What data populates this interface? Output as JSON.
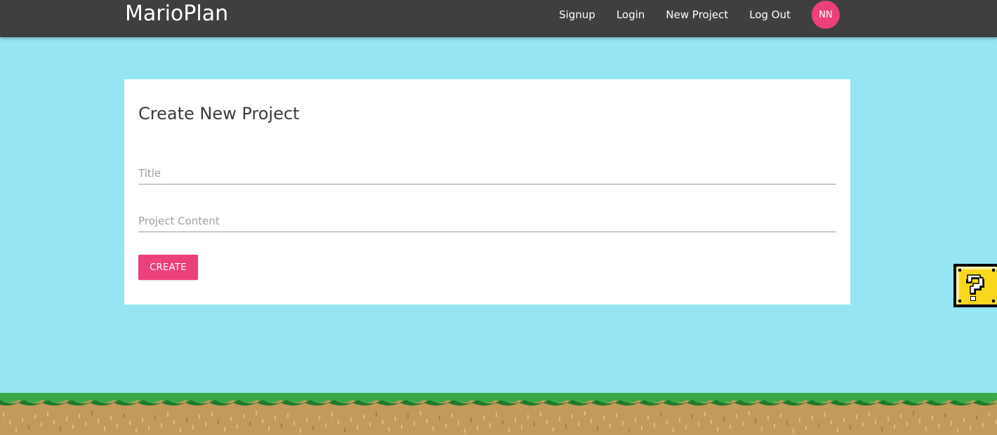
{
  "nav": {
    "brand": "MarioPlan",
    "links": [
      "Signup",
      "Login",
      "New Project",
      "Log Out"
    ],
    "avatar_initials": "NN"
  },
  "form": {
    "heading": "Create New Project",
    "title_placeholder": "Title",
    "content_placeholder": "Project Content",
    "create_label": "CREATE"
  },
  "decor": {
    "question_block_icon": "question-block-icon",
    "ground_icon": "grass-ground-icon"
  },
  "colors": {
    "navbar": "#3f3f3f",
    "sky": "#95e6f2",
    "accent": "#ec407a",
    "grass": "#3aa848",
    "dirt": "#c29a5a"
  }
}
